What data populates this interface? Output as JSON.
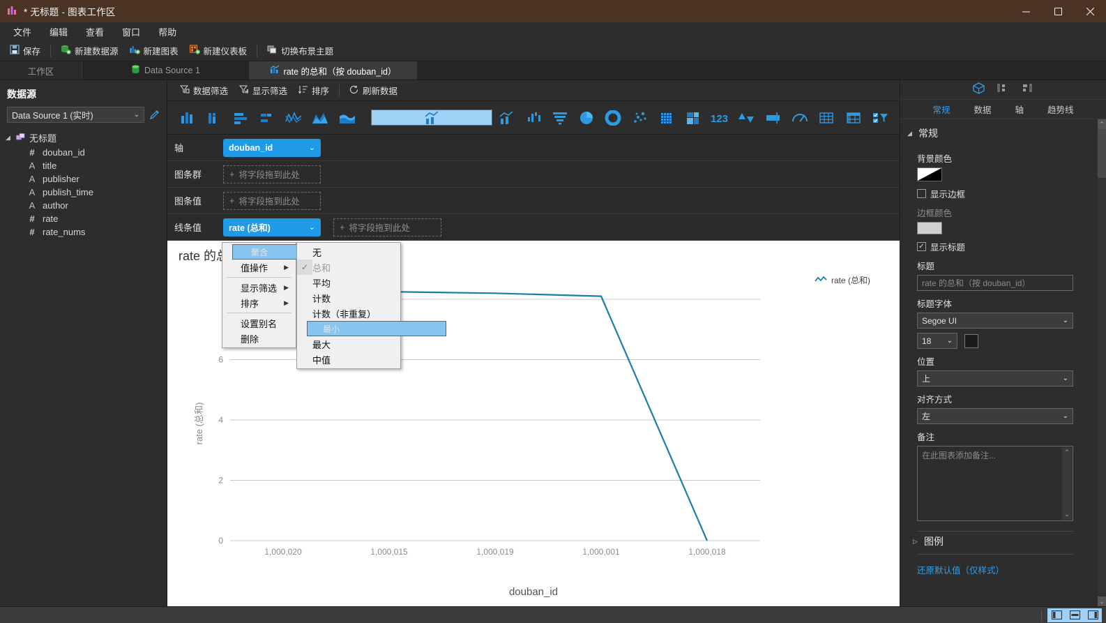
{
  "window": {
    "title": "* 无标题 - 图表工作区",
    "app_icon": "chart-bars-icon",
    "minimize": "–",
    "maximize": "▢",
    "close": "✕",
    "titlebar_color": "#4b3324"
  },
  "menubar": {
    "items": [
      "文件",
      "编辑",
      "查看",
      "窗口",
      "帮助"
    ]
  },
  "toolbar": {
    "items": [
      {
        "label": "保存",
        "icon": "save-icon"
      },
      {
        "label": "新建数据源",
        "icon": "new-datasource-icon"
      },
      {
        "label": "新建图表",
        "icon": "new-chart-icon"
      },
      {
        "label": "新建仪表板",
        "icon": "new-dashboard-icon"
      }
    ],
    "theme_toggle": {
      "label": "切换布景主题",
      "icon": "theme-switch-icon"
    }
  },
  "tabs": [
    {
      "label": "工作区",
      "active": false,
      "icon": ""
    },
    {
      "label": "Data Source 1",
      "active": false,
      "icon": "database-icon"
    },
    {
      "label": "rate 的总和（按 douban_id）",
      "active": true,
      "icon": "chart-icon"
    }
  ],
  "left_panel": {
    "title": "数据源",
    "datasource_value": "Data Source 1 (实时)",
    "edit_icon": "pencil-icon",
    "tree_root": "无标题",
    "fields": [
      {
        "type": "#",
        "name": "douban_id"
      },
      {
        "type": "A",
        "name": "title"
      },
      {
        "type": "A",
        "name": "publisher"
      },
      {
        "type": "A",
        "name": "publish_time"
      },
      {
        "type": "A",
        "name": "author"
      },
      {
        "type": "#",
        "name": "rate"
      },
      {
        "type": "#",
        "name": "rate_nums"
      }
    ]
  },
  "chart_toolbar": {
    "items": [
      {
        "label": "数据筛选",
        "icon": "data-filter-icon"
      },
      {
        "label": "显示筛选",
        "icon": "display-filter-icon"
      },
      {
        "label": "排序",
        "icon": "sort-icon"
      },
      {
        "label": "刷新数据",
        "icon": "refresh-icon"
      }
    ]
  },
  "chart_types": [
    {
      "name": "column-chart-icon",
      "selected": false
    },
    {
      "name": "stacked-column-chart-icon",
      "selected": false
    },
    {
      "name": "bar-chart-icon",
      "selected": false
    },
    {
      "name": "stacked-bar-chart-icon",
      "selected": false
    },
    {
      "name": "line-chart-icon",
      "selected": false
    },
    {
      "name": "area-chart-icon",
      "selected": false
    },
    {
      "name": "stacked-area-chart-icon",
      "selected": false
    },
    {
      "name": "combo-bar-line-chart-icon",
      "selected": true
    },
    {
      "name": "bar-line-chart-icon",
      "selected": false
    },
    {
      "name": "range-bar-chart-icon",
      "selected": false
    },
    {
      "name": "funnel-chart-icon",
      "selected": false
    },
    {
      "name": "pie-chart-icon",
      "selected": false
    },
    {
      "name": "donut-chart-icon",
      "selected": false
    },
    {
      "name": "scatter-chart-icon",
      "selected": false
    },
    {
      "name": "heatmap-chart-icon",
      "selected": false
    },
    {
      "name": "treemap-chart-icon",
      "selected": false
    },
    {
      "name": "number-card-icon",
      "selected": false
    },
    {
      "name": "kpi-updown-icon",
      "selected": false
    },
    {
      "name": "bullet-chart-icon",
      "selected": false
    },
    {
      "name": "gauge-chart-icon",
      "selected": false
    },
    {
      "name": "table-icon",
      "selected": false
    },
    {
      "name": "pivot-table-icon",
      "selected": false
    },
    {
      "name": "filter-list-icon",
      "selected": false
    }
  ],
  "shelves": [
    {
      "label": "轴",
      "pill": "douban_id",
      "dropzone": null
    },
    {
      "label": "图条群",
      "pill": null,
      "dropzone": "将字段拖到此处"
    },
    {
      "label": "图条值",
      "pill": null,
      "dropzone": "将字段拖到此处"
    },
    {
      "label": "线条值",
      "pill": "rate (总和)",
      "dropzone": "将字段拖到此处"
    }
  ],
  "context_menu": {
    "main": [
      {
        "label": "聚合",
        "submenu": true,
        "selected": true
      },
      {
        "label": "值操作",
        "submenu": true,
        "selected": false
      },
      {
        "separator": true
      },
      {
        "label": "显示筛选",
        "submenu": true,
        "selected": false
      },
      {
        "label": "排序",
        "submenu": true,
        "selected": false
      },
      {
        "separator": true
      },
      {
        "label": "设置别名",
        "submenu": false,
        "selected": false
      },
      {
        "label": "删除",
        "submenu": false,
        "selected": false
      }
    ],
    "submenu": [
      {
        "label": "无",
        "checked": false,
        "highlighted": false,
        "disabled": false
      },
      {
        "label": "总和",
        "checked": true,
        "highlighted": false,
        "disabled": true
      },
      {
        "label": "平均",
        "checked": false,
        "highlighted": false,
        "disabled": false
      },
      {
        "label": "计数",
        "checked": false,
        "highlighted": false,
        "disabled": false
      },
      {
        "label": "计数（非重复）",
        "checked": false,
        "highlighted": false,
        "disabled": false
      },
      {
        "label": "最小",
        "checked": false,
        "highlighted": true,
        "disabled": false
      },
      {
        "label": "最大",
        "checked": false,
        "highlighted": false,
        "disabled": false
      },
      {
        "label": "中值",
        "checked": false,
        "highlighted": false,
        "disabled": false
      }
    ]
  },
  "chart_data": {
    "type": "line",
    "title": "rate 的总和（按 douban_id）",
    "xlabel": "douban_id",
    "ylabel": "rate (总和)",
    "categories": [
      "1,000,020",
      "1,000,015",
      "1,000,019",
      "1,000,001",
      "1,000,018"
    ],
    "series": [
      {
        "name": "rate (总和)",
        "values": [
          8.3,
          8.25,
          8.2,
          8.1,
          0
        ],
        "color": "#1a7fa8"
      }
    ],
    "yticks": [
      0,
      2,
      4,
      6
    ],
    "ylim": [
      0,
      8.6
    ],
    "grid": true,
    "legend_position": "top-right",
    "legend_entries": [
      "rate (总和)"
    ]
  },
  "right_panel": {
    "top_icons": [
      "cube-icon",
      "layout-left-icon",
      "layout-right-icon"
    ],
    "tabs": [
      {
        "label": "常规",
        "active": true
      },
      {
        "label": "数据",
        "active": false
      },
      {
        "label": "轴",
        "active": false
      },
      {
        "label": "趋势线",
        "active": false
      }
    ],
    "section_general": "常规",
    "bg_color_label": "背景颜色",
    "show_border_label": "显示边框",
    "show_border_checked": false,
    "border_color_label": "边框颜色",
    "show_title_label": "显示标题",
    "show_title_checked": true,
    "title_label": "标题",
    "title_placeholder": "rate 的总和（按 douban_id）",
    "title_font_label": "标题字体",
    "title_font_value": "Segoe UI",
    "title_size_value": "18",
    "position_label": "位置",
    "position_value": "上",
    "align_label": "对齐方式",
    "align_value": "左",
    "note_label": "备注",
    "note_placeholder": "在此图表添加备注...",
    "section_legend": "图例",
    "restore_defaults": "还原默认值（仅样式）"
  },
  "status_bar": {
    "layout_buttons": [
      "layout-left-panel-icon",
      "layout-bottom-panel-icon",
      "layout-right-panel-icon"
    ]
  },
  "colors": {
    "accent": "#1e9ae6",
    "title_bar": "#4b3324",
    "panel_bg": "#2d2d2d",
    "chart_line": "#1a7fa8",
    "menu_highlight": "#85c5ef"
  }
}
